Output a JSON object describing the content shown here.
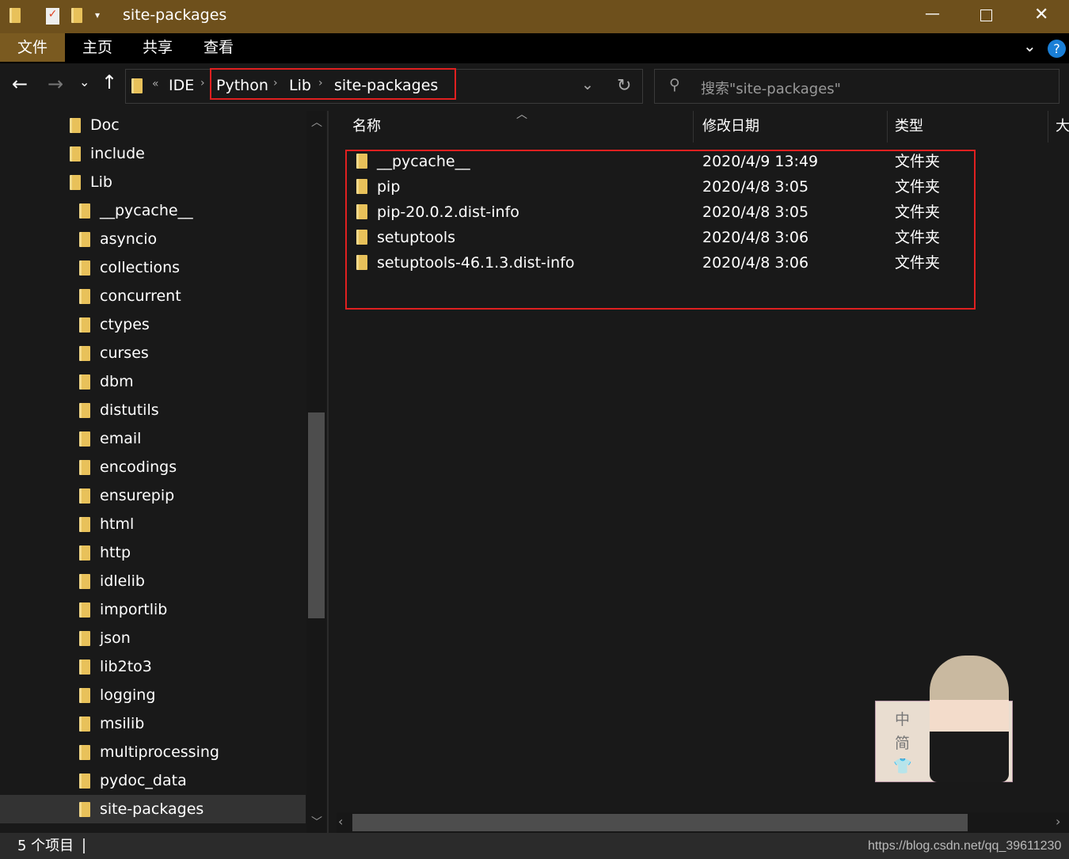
{
  "window": {
    "title": "site-packages"
  },
  "ribbon": {
    "tabs": [
      "文件",
      "主页",
      "共享",
      "查看"
    ]
  },
  "address": {
    "overflow": "«",
    "segments": [
      "IDE",
      "Python",
      "Lib",
      "site-packages"
    ]
  },
  "search": {
    "placeholder": "搜索\"site-packages\""
  },
  "sidebar": {
    "items": [
      {
        "label": "Doc",
        "level": 1
      },
      {
        "label": "include",
        "level": 1
      },
      {
        "label": "Lib",
        "level": 1
      },
      {
        "label": "__pycache__",
        "level": 2
      },
      {
        "label": "asyncio",
        "level": 2
      },
      {
        "label": "collections",
        "level": 2
      },
      {
        "label": "concurrent",
        "level": 2
      },
      {
        "label": "ctypes",
        "level": 2
      },
      {
        "label": "curses",
        "level": 2
      },
      {
        "label": "dbm",
        "level": 2
      },
      {
        "label": "distutils",
        "level": 2
      },
      {
        "label": "email",
        "level": 2
      },
      {
        "label": "encodings",
        "level": 2
      },
      {
        "label": "ensurepip",
        "level": 2
      },
      {
        "label": "html",
        "level": 2
      },
      {
        "label": "http",
        "level": 2
      },
      {
        "label": "idlelib",
        "level": 2
      },
      {
        "label": "importlib",
        "level": 2
      },
      {
        "label": "json",
        "level": 2
      },
      {
        "label": "lib2to3",
        "level": 2
      },
      {
        "label": "logging",
        "level": 2
      },
      {
        "label": "msilib",
        "level": 2
      },
      {
        "label": "multiprocessing",
        "level": 2
      },
      {
        "label": "pydoc_data",
        "level": 2
      },
      {
        "label": "site-packages",
        "level": 2,
        "selected": true
      }
    ]
  },
  "columns": {
    "name": "名称",
    "date": "修改日期",
    "type": "类型",
    "size": "大"
  },
  "files": [
    {
      "name": "__pycache__",
      "date": "2020/4/9 13:49",
      "type": "文件夹"
    },
    {
      "name": "pip",
      "date": "2020/4/8 3:05",
      "type": "文件夹"
    },
    {
      "name": "pip-20.0.2.dist-info",
      "date": "2020/4/8 3:05",
      "type": "文件夹"
    },
    {
      "name": "setuptools",
      "date": "2020/4/8 3:06",
      "type": "文件夹"
    },
    {
      "name": "setuptools-46.1.3.dist-info",
      "date": "2020/4/8 3:06",
      "type": "文件夹"
    }
  ],
  "status": {
    "count": "5 个项目",
    "watermark": "https://blog.csdn.net/qq_39611230"
  },
  "ime": {
    "chars": [
      "中",
      "简"
    ]
  },
  "colors": {
    "titlebar": "#6e501c",
    "highlight": "#e02020",
    "folder": "#e8c15a"
  }
}
